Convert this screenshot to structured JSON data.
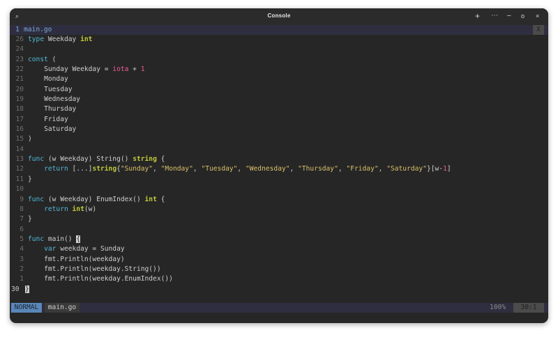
{
  "window": {
    "title": "Console",
    "icons": {
      "search": "search-icon",
      "new_tab": "plus-icon",
      "menu": "ellipsis-icon",
      "minimize": "minimize-icon",
      "maximize": "maximize-icon",
      "close": "close-icon"
    },
    "glyphs": {
      "search": "⌕",
      "new_tab": "+",
      "menu": "⋯",
      "minimize": "–",
      "maximize": "o",
      "close": "×"
    }
  },
  "tabline": {
    "number": "1",
    "filename": "main.go",
    "close_label": "X"
  },
  "editor": {
    "line_numbers": [
      "26",
      "24",
      "23",
      "22",
      "21",
      "20",
      "19",
      "18",
      "17",
      "16",
      "15",
      "14",
      "13",
      "12",
      "11",
      "10",
      "9",
      "8",
      "7",
      "6",
      "5",
      "4",
      "3",
      "2",
      "1",
      "30"
    ],
    "lines": [
      [
        {
          "t": "type ",
          "c": "kw"
        },
        {
          "t": "Weekday "
        },
        {
          "t": "int",
          "c": "ty"
        }
      ],
      [],
      [
        {
          "t": "const ",
          "c": "kw"
        },
        {
          "t": "("
        }
      ],
      [
        {
          "t": "    Sunday Weekday = "
        },
        {
          "t": "iota",
          "c": "cn"
        },
        {
          "t": " + "
        },
        {
          "t": "1",
          "c": "cn"
        }
      ],
      [
        {
          "t": "    Monday"
        }
      ],
      [
        {
          "t": "    Tuesday"
        }
      ],
      [
        {
          "t": "    Wednesday"
        }
      ],
      [
        {
          "t": "    Thursday"
        }
      ],
      [
        {
          "t": "    Friday"
        }
      ],
      [
        {
          "t": "    Saturday"
        }
      ],
      [
        {
          "t": ")"
        }
      ],
      [],
      [
        {
          "t": "func ",
          "c": "kw"
        },
        {
          "t": "(w Weekday) String() "
        },
        {
          "t": "string",
          "c": "ty"
        },
        {
          "t": " {"
        }
      ],
      [
        {
          "t": "    "
        },
        {
          "t": "return ",
          "c": "kw"
        },
        {
          "t": "[...]"
        },
        {
          "t": "string",
          "c": "ty"
        },
        {
          "t": "{"
        },
        {
          "t": "\"Sunday\"",
          "c": "st"
        },
        {
          "t": ", "
        },
        {
          "t": "\"Monday\"",
          "c": "st"
        },
        {
          "t": ", "
        },
        {
          "t": "\"Tuesday\"",
          "c": "st"
        },
        {
          "t": ", "
        },
        {
          "t": "\"Wednesday\"",
          "c": "st"
        },
        {
          "t": ", "
        },
        {
          "t": "\"Thursday\"",
          "c": "st"
        },
        {
          "t": ", "
        },
        {
          "t": "\"Friday\"",
          "c": "st"
        },
        {
          "t": ", "
        },
        {
          "t": "\"Saturday\"",
          "c": "st"
        },
        {
          "t": "}[w-"
        },
        {
          "t": "1",
          "c": "cn"
        },
        {
          "t": "]"
        }
      ],
      [
        {
          "t": "}"
        }
      ],
      [],
      [
        {
          "t": "func ",
          "c": "kw"
        },
        {
          "t": "(w Weekday) EnumIndex() "
        },
        {
          "t": "int",
          "c": "ty"
        },
        {
          "t": " {"
        }
      ],
      [
        {
          "t": "    "
        },
        {
          "t": "return ",
          "c": "kw"
        },
        {
          "t": "int",
          "c": "ty"
        },
        {
          "t": "(w)"
        }
      ],
      [
        {
          "t": "}"
        }
      ],
      [],
      [
        {
          "t": "func ",
          "c": "kw"
        },
        {
          "t": "main() "
        },
        {
          "t": "{",
          "c": "cursor"
        }
      ],
      [
        {
          "t": "    "
        },
        {
          "t": "var ",
          "c": "kw"
        },
        {
          "t": "weekday = Sunday"
        }
      ],
      [
        {
          "t": "    fmt.Println(weekday)"
        }
      ],
      [
        {
          "t": "    fmt.Println(weekday.String())"
        }
      ],
      [
        {
          "t": "    fmt.Println(weekday.EnumIndex())"
        }
      ],
      [
        {
          "t": "}",
          "c": "cursor"
        }
      ]
    ]
  },
  "statusline": {
    "mode": "NORMAL",
    "filename": "main.go",
    "percent": "100%",
    "position": "30:1"
  },
  "colors": {
    "background": "#262626",
    "keyword": "#53b8d6",
    "type": "#c3c93a",
    "number": "#ec5f9a",
    "string": "#d9c06a",
    "mode": "#5a87b8"
  }
}
